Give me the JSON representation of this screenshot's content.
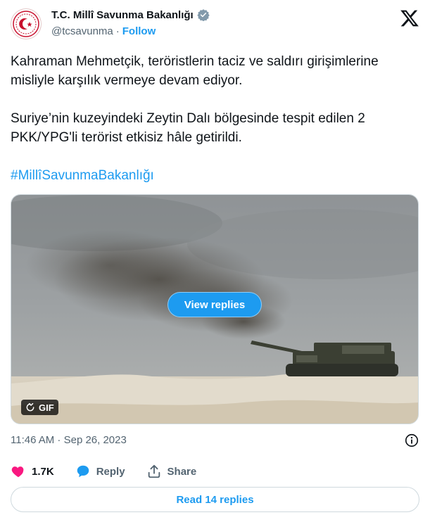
{
  "header": {
    "display_name": "T.C. Millî Savunma Bakanlığı",
    "handle": "@tcsavunma",
    "separator": "·",
    "follow_label": "Follow"
  },
  "tweet": {
    "text": "Kahraman Mehmetçik, teröristlerin taciz ve saldırı girişimlerine misliyle karşılık vermeye devam ediyor.\n\nSuriye’nin kuzeyindeki Zeytin Dalı bölgesinde tespit edilen 2 PKK/YPG'li terörist etkisiz hâle getirildi.",
    "hashtag": "#MillîSavunmaBakanlığı"
  },
  "media": {
    "view_replies_label": "View replies",
    "gif_label": "GIF"
  },
  "meta": {
    "timestamp": "11:46 AM · Sep 26, 2023"
  },
  "actions": {
    "like_count": "1.7K",
    "reply_label": "Reply",
    "share_label": "Share"
  },
  "footer": {
    "read_replies_label": "Read 14 replies"
  },
  "colors": {
    "accent": "#1d9bf0",
    "like": "#f91880",
    "text": "#0f1419",
    "secondary": "#536471"
  },
  "icons": [
    "ministry-emblem-icon",
    "verified-badge-icon",
    "x-logo-icon",
    "replay-icon",
    "info-icon",
    "heart-icon",
    "reply-bubble-icon",
    "share-icon"
  ]
}
